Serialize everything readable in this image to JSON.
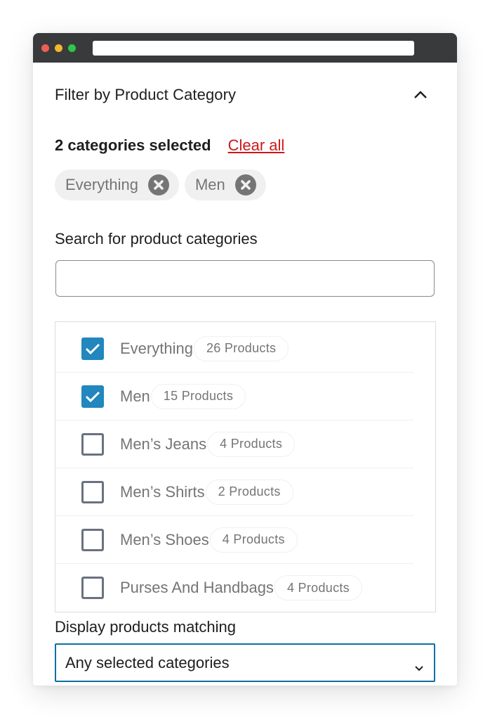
{
  "window": {
    "url": ""
  },
  "header": {
    "title": "Filter by Product Category",
    "collapse_icon": "chevron-up-icon"
  },
  "selection": {
    "count_label": "2 categories selected",
    "clear_all_label": "Clear all",
    "chips": [
      {
        "label": "Everything",
        "remove_icon": "remove-circle-icon"
      },
      {
        "label": "Men",
        "remove_icon": "remove-circle-icon"
      }
    ]
  },
  "search": {
    "label": "Search for product categories",
    "value": "",
    "placeholder": ""
  },
  "categories": [
    {
      "label": "Everything",
      "count": "26 Products",
      "checked": true
    },
    {
      "label": "Men",
      "count": "15 Products",
      "checked": true
    },
    {
      "label": "Men’s Jeans",
      "count": "4 Products",
      "checked": false
    },
    {
      "label": "Men’s Shirts",
      "count": "2 Products",
      "checked": false
    },
    {
      "label": "Men’s Shoes",
      "count": "4 Products",
      "checked": false
    },
    {
      "label": "Purses And Handbags",
      "count": "4 Products",
      "checked": false
    }
  ],
  "match": {
    "label": "Display products matching",
    "selected": "Any selected categories"
  },
  "colors": {
    "accent": "#2187be",
    "select_border": "#0d6fa3",
    "clear_all": "#cc1818",
    "titlebar": "#393a3c"
  }
}
